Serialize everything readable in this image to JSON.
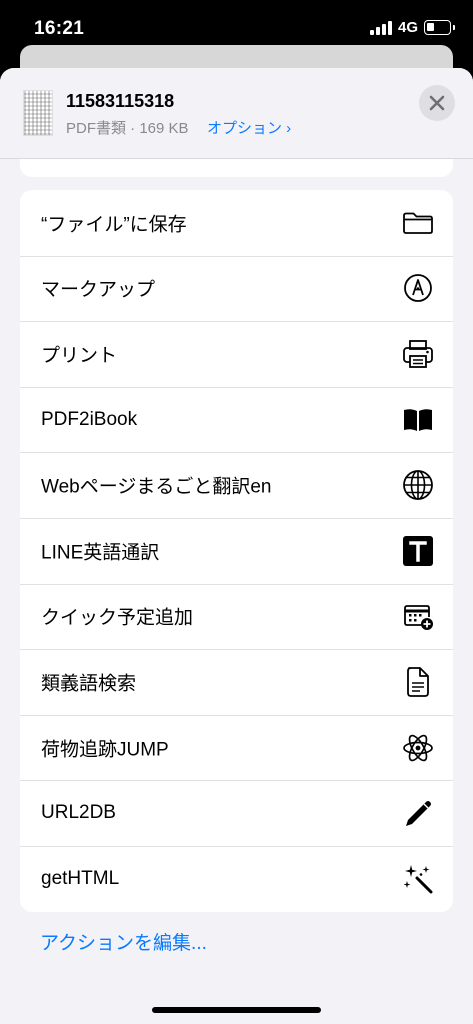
{
  "status_bar": {
    "time": "16:21",
    "network": "4G",
    "signal_icon": "cellular-signal-icon",
    "battery_icon": "battery-low-icon"
  },
  "document": {
    "title": "11583115318",
    "meta": "PDF書類 · 169 KB",
    "options_label": "オプション ›",
    "thumbnail_icon": "pdf-thumbnail"
  },
  "actions": [
    {
      "label": "“ファイル”に保存",
      "icon": "folder-icon"
    },
    {
      "label": "マークアップ",
      "icon": "markup-pen-icon"
    },
    {
      "label": "プリント",
      "icon": "printer-icon"
    },
    {
      "label": "PDF2iBook",
      "icon": "book-icon"
    },
    {
      "label": "Webページまるごと翻訳en",
      "icon": "globe-icon"
    },
    {
      "label": "LINE英語通訳",
      "icon": "text-t-icon"
    },
    {
      "label": "クイック予定追加",
      "icon": "calendar-add-icon"
    },
    {
      "label": "類義語検索",
      "icon": "document-icon"
    },
    {
      "label": "荷物追跡JUMP",
      "icon": "atom-icon"
    },
    {
      "label": "URL2DB",
      "icon": "pencil-icon"
    },
    {
      "label": "getHTML",
      "icon": "magic-wand-icon"
    }
  ],
  "footer": {
    "edit_actions": "アクションを編集..."
  },
  "colors": {
    "accent": "#0a7aff",
    "sheet_bg": "#f2f2f7",
    "row_bg": "#ffffff",
    "secondary_text": "#8a8a8e"
  }
}
